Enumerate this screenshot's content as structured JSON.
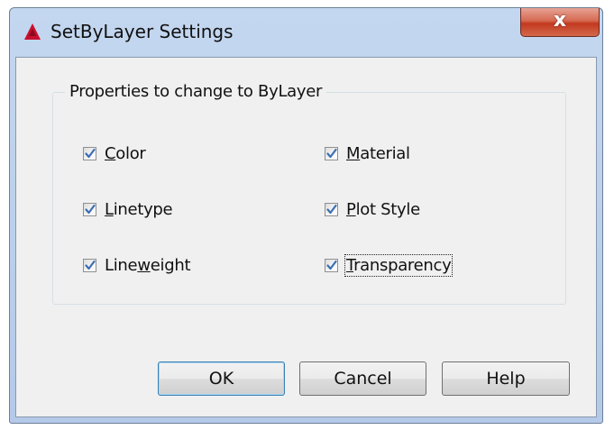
{
  "window": {
    "title": "SetByLayer Settings",
    "icon": "autocad-logo-icon",
    "close_label": "x"
  },
  "group": {
    "legend": "Properties to change to ByLayer"
  },
  "checkboxes": [
    {
      "label": "Color",
      "mnemonic": "C",
      "checked": true,
      "column": "left"
    },
    {
      "label": "Linetype",
      "mnemonic": "L",
      "checked": true,
      "column": "left"
    },
    {
      "label": "Lineweight",
      "mnemonic": "w",
      "checked": true,
      "column": "left"
    },
    {
      "label": "Material",
      "mnemonic": "M",
      "checked": true,
      "column": "right"
    },
    {
      "label": "Plot Style",
      "mnemonic": "P",
      "checked": true,
      "column": "right"
    },
    {
      "label": "Transparency",
      "mnemonic": "T",
      "checked": true,
      "column": "right",
      "focused": true
    }
  ],
  "buttons": {
    "ok": "OK",
    "cancel": "Cancel",
    "help": "Help"
  },
  "colors": {
    "title_gradient": "#c4d7f0",
    "close_red": "#c2391f",
    "dialog_face": "#f0f0f0",
    "check_blue": "#3c6fb4",
    "default_button_border": "#3c7fb1"
  }
}
